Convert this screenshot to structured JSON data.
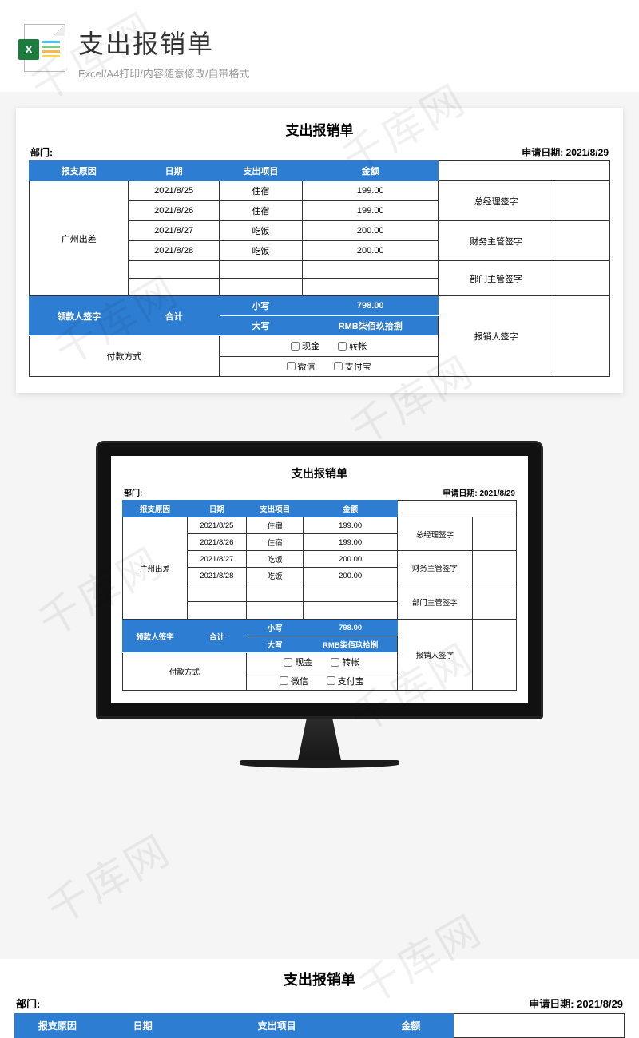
{
  "header": {
    "title": "支出报销单",
    "subtitle": "Excel/A4打印/内容随意修改/自带格式",
    "icon_letter": "X"
  },
  "watermark": "千库网",
  "sheet": {
    "title": "支出报销单",
    "dept_label": "部门:",
    "apply_date_label": "申请日期:",
    "apply_date": "2021/8/29",
    "columns": {
      "reason": "报支原因",
      "date": "日期",
      "item": "支出项目",
      "amount": "金额"
    },
    "reason_value": "广州出差",
    "rows": [
      {
        "date": "2021/8/25",
        "item": "住宿",
        "amount": "199.00"
      },
      {
        "date": "2021/8/26",
        "item": "住宿",
        "amount": "199.00"
      },
      {
        "date": "2021/8/27",
        "item": "吃饭",
        "amount": "200.00"
      },
      {
        "date": "2021/8/28",
        "item": "吃饭",
        "amount": "200.00"
      }
    ],
    "signatures": {
      "gm": "总经理签字",
      "finance": "财务主管签字",
      "dept": "部门主管签字",
      "claimer": "报销人签字",
      "payee": "领款人签字"
    },
    "total": {
      "label": "合计",
      "lower_label": "小写",
      "lower_value": "798.00",
      "upper_label": "大写",
      "upper_value": "RMB柒佰玖拾捌"
    },
    "payment": {
      "label": "付款方式",
      "options": {
        "cash": "现金",
        "transfer": "转帐",
        "wechat": "微信",
        "alipay": "支付宝"
      }
    }
  }
}
